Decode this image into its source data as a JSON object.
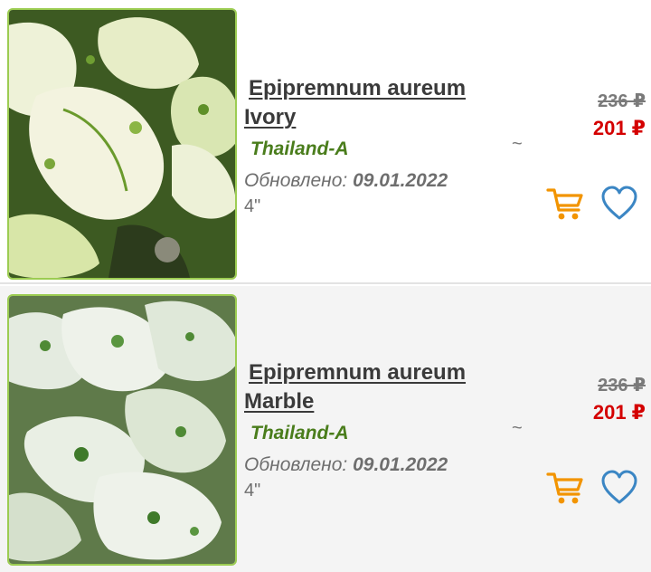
{
  "colors": {
    "title": "#3a3a3a",
    "origin": "#4a7d1c",
    "old_price": "#7a7a7a",
    "new_price": "#d40000",
    "cart_icon": "#f29400",
    "heart_icon": "#3b86c4",
    "thumb_border": "#9ccc52"
  },
  "products": [
    {
      "name_line1": "Epipremnum aureum",
      "name_line2": "Ivory",
      "origin": "Thailand-A",
      "updated_label": "Обновлено:",
      "updated_date": "09.01.2022",
      "size": "4\"",
      "approx": "~",
      "old_price": "236 ₽",
      "price": "201 ₽",
      "image_icon": "ivory-pothos-photo",
      "cart_icon": "shopping-cart-icon",
      "fav_icon": "heart-icon"
    },
    {
      "name_line1": "Epipremnum aureum",
      "name_line2": "Marble",
      "origin": "Thailand-A",
      "updated_label": "Обновлено:",
      "updated_date": "09.01.2022",
      "size": "4\"",
      "approx": "~",
      "old_price": "236 ₽",
      "price": "201 ₽",
      "image_icon": "marble-pothos-photo",
      "cart_icon": "shopping-cart-icon",
      "fav_icon": "heart-icon"
    }
  ]
}
